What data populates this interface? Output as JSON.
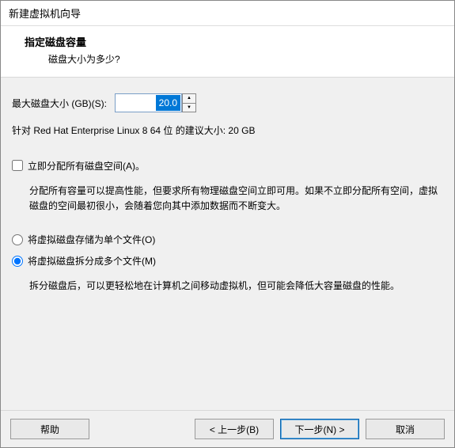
{
  "window": {
    "title": "新建虚拟机向导"
  },
  "header": {
    "title": "指定磁盘容量",
    "subtitle": "磁盘大小为多少?"
  },
  "size": {
    "label": "最大磁盘大小 (GB)(S):",
    "value": "20.0",
    "recommend": "针对 Red Hat Enterprise Linux 8 64 位 的建议大小: 20 GB"
  },
  "allocate": {
    "label": "立即分配所有磁盘空间(A)。",
    "desc": "分配所有容量可以提高性能，但要求所有物理磁盘空间立即可用。如果不立即分配所有空间，虚拟磁盘的空间最初很小，会随着您向其中添加数据而不断变大。"
  },
  "storage": {
    "single": "将虚拟磁盘存储为单个文件(O)",
    "split": "将虚拟磁盘拆分成多个文件(M)",
    "split_desc": "拆分磁盘后，可以更轻松地在计算机之间移动虚拟机，但可能会降低大容量磁盘的性能。"
  },
  "footer": {
    "help": "帮助",
    "back": "< 上一步(B)",
    "next": "下一步(N) >",
    "cancel": "取消"
  }
}
